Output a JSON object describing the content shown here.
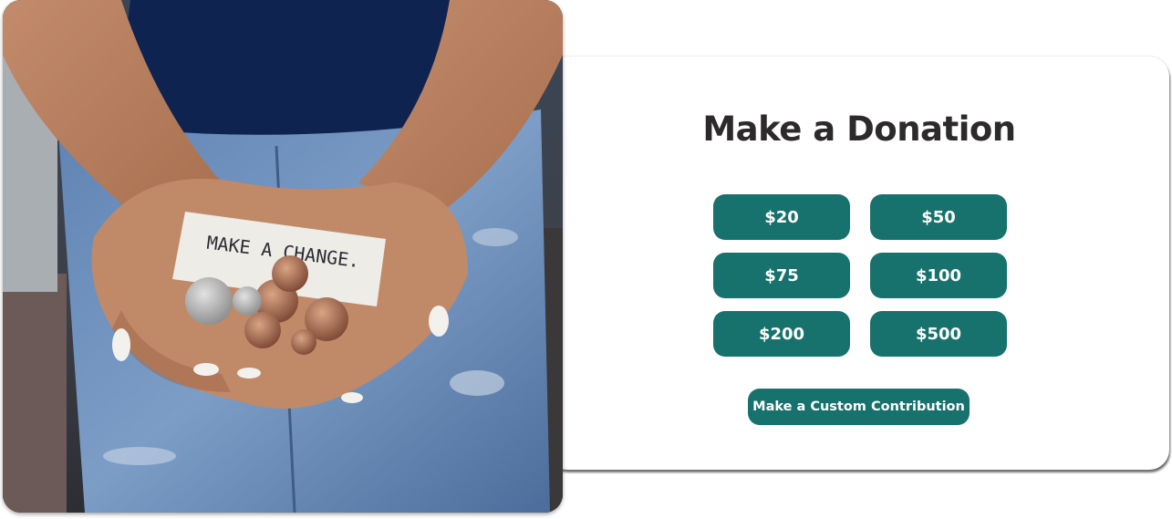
{
  "photo": {
    "alt": "Cupped hands holding coins and a torn paper note",
    "note_text": "MAKE A CHANGE."
  },
  "donation": {
    "title": "Make a Donation",
    "amounts": [
      {
        "label": "$20"
      },
      {
        "label": "$50"
      },
      {
        "label": "$75"
      },
      {
        "label": "$100"
      },
      {
        "label": "$200"
      },
      {
        "label": "$500"
      }
    ],
    "custom_label": "Make a Custom Contribution"
  },
  "colors": {
    "button": "#17716c",
    "title": "#2d2a2b",
    "background": "#ffffff"
  }
}
